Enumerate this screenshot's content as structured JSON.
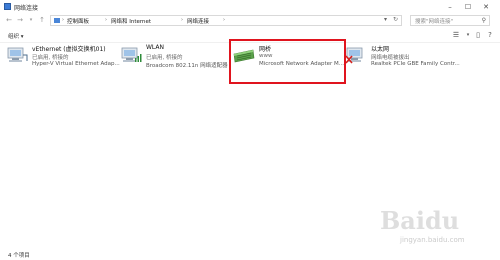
{
  "window": {
    "title": "网络连接"
  },
  "address": {
    "breadcrumbs": [
      "控制面板",
      "网络和 Internet",
      "网络连接"
    ],
    "search_placeholder": "搜索\"网络连接\""
  },
  "toolbar": {
    "organize_label": "组织 ▾"
  },
  "adapters": [
    {
      "name": "vEthernet (虚拟交换机01)",
      "status": "已启用, 桥接的",
      "device": "Hyper-V Virtual Ethernet Adap...",
      "icon": "ethernet-adapter-icon"
    },
    {
      "name": "WLAN",
      "status": "已启用, 桥接的",
      "device": "Broadcom 802.11n 网络适配器",
      "icon": "wireless-adapter-icon"
    },
    {
      "name": "网桥",
      "status": "www",
      "device": "Microsoft Network Adapter M...",
      "icon": "network-bridge-icon"
    },
    {
      "name": "以太网",
      "status": "网络电缆被拔出",
      "device": "Realtek PCIe GBE Family Contr...",
      "icon": "ethernet-disconnected-icon"
    }
  ],
  "statusbar": {
    "item_count": "4 个项目"
  },
  "watermark": {
    "main": "Baidu",
    "sub": "jingyan.baidu.com"
  },
  "colors": {
    "highlight": "#e0141e",
    "accent": "#3b7bd6"
  }
}
